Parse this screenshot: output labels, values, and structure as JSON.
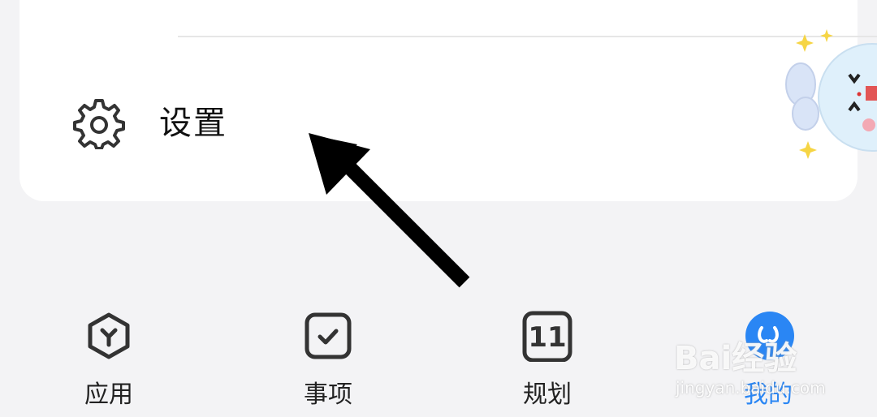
{
  "settings": {
    "label": "设置",
    "icon": "gear-icon"
  },
  "nav": {
    "items": [
      {
        "label": "应用",
        "icon": "apps-hexagon-icon",
        "active": false
      },
      {
        "label": "事项",
        "icon": "checkbox-icon",
        "active": false
      },
      {
        "label": "规划",
        "icon": "calendar-icon",
        "active": false,
        "badge": "11"
      },
      {
        "label": "我的",
        "icon": "profile-icon",
        "active": true
      }
    ]
  },
  "watermark": {
    "main": "Bai经验",
    "sub": "jingyan.baidu.com"
  },
  "colors": {
    "accent": "#2a86f4",
    "background": "#f3f3f5",
    "card": "#ffffff",
    "text": "#111111"
  }
}
